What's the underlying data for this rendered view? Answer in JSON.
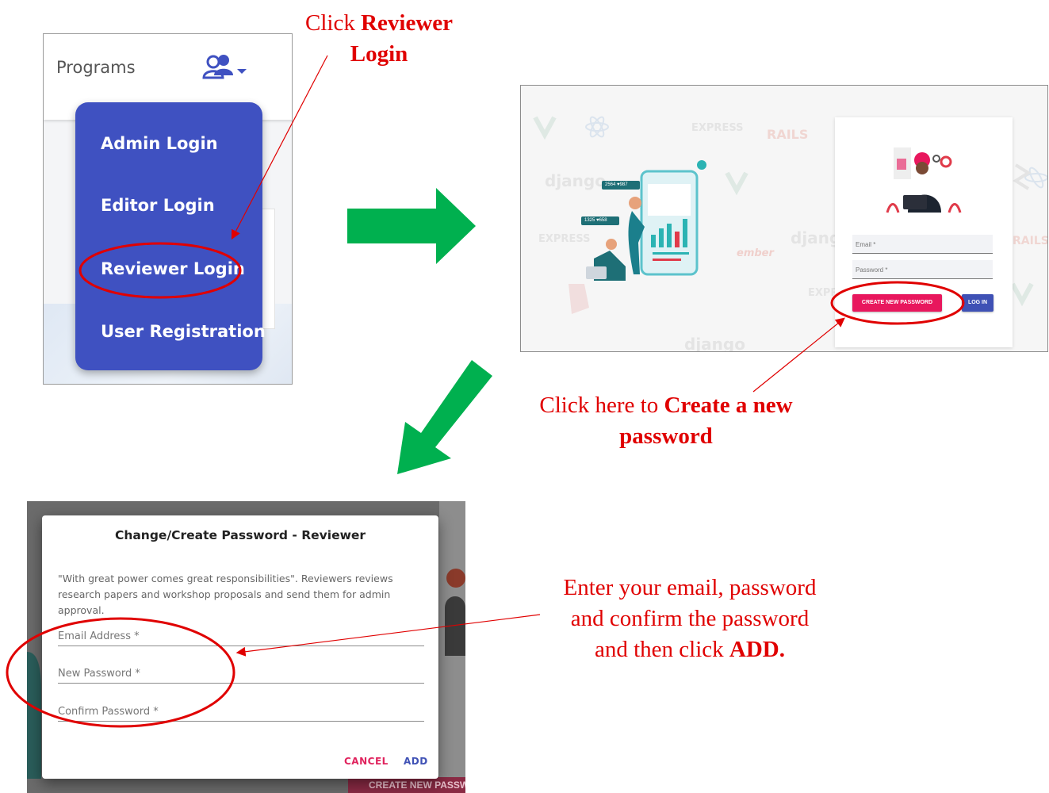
{
  "colors": {
    "annotation": "#e00000",
    "arrow_green": "#00b04f",
    "menu_blue": "#3f51c1",
    "create_pink": "#e8175d",
    "login_blue": "#3f51b5"
  },
  "annotations": {
    "step1_prefix": "Click ",
    "step1_bold_a": "Reviewer",
    "step1_bold_b": "Login",
    "step2_prefix": "Click here to ",
    "step2_bold_a": "Create a new",
    "step2_bold_b": "password",
    "step3_line1": "Enter your email, password",
    "step3_line2": "and confirm the password",
    "step3_line3_prefix": "and then click ",
    "step3_line3_bold": "ADD."
  },
  "programs_panel": {
    "title": "Programs",
    "user_icon": "user-group-icon",
    "dropdown_icon": "caret-down-icon",
    "menu": [
      "Admin Login",
      "Editor Login",
      "Reviewer Login",
      "User Registration"
    ]
  },
  "login_panel": {
    "background_logos": [
      "EXPRESS",
      "RAILS",
      "django",
      "EXPRESS",
      "django",
      "EXPRESS",
      "django",
      "ember",
      "RAILS"
    ],
    "stat_badge_1": "2564",
    "stat_badge_1b": "987",
    "stat_badge_2": "1325",
    "stat_badge_2b": "658",
    "email_label": "Email *",
    "password_label": "Password *",
    "create_button": "CREATE NEW PASSWORD",
    "login_button": "LOG IN"
  },
  "dialog_panel": {
    "title": "Change/Create Password - Reviewer",
    "description": "\"With great power comes great responsibilities\". Reviewers reviews research papers and workshop proposals and send them for admin approval.",
    "email_label": "Email Address *",
    "new_password_label": "New Password *",
    "confirm_password_label": "Confirm Password *",
    "cancel_button": "CANCEL",
    "add_button": "ADD",
    "background_button_peek": "CREATE NEW PASSWORD"
  }
}
